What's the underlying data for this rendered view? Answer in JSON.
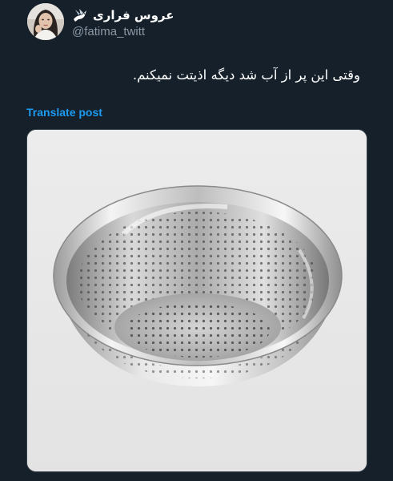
{
  "author": {
    "display_name": "عروس فراری",
    "handle": "@fatima_twitt",
    "badge_icon": "dove-icon",
    "avatar_icon": "avatar-photo"
  },
  "post": {
    "text": "وقتی این پر از آب شد دیگه اذیتت نمیکنم.",
    "translate_label": "Translate post"
  },
  "media": {
    "subject": "colander-image",
    "background": "#e9e9ea"
  },
  "colors": {
    "background": "#15202b",
    "link": "#1d9bf0",
    "secondary_text": "#8b98a5"
  }
}
